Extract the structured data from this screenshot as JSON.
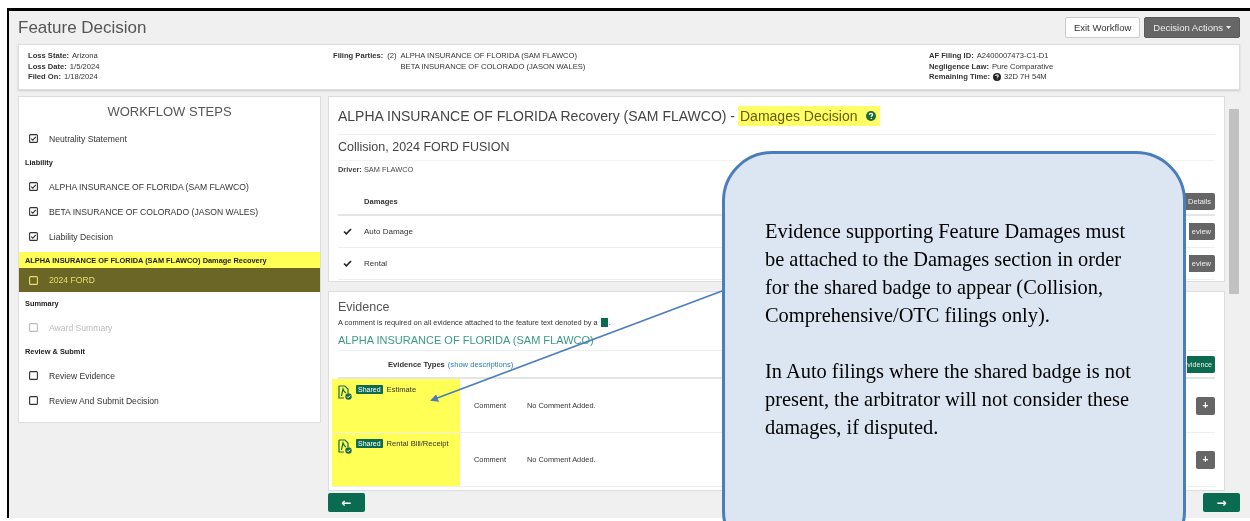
{
  "page": {
    "title": "Feature Decision",
    "buttons": [
      {
        "label": "Exit Workflow",
        "kind": "plain"
      },
      {
        "label": "Decision Actions",
        "kind": "dropdown"
      }
    ]
  },
  "summary": {
    "left": [
      {
        "label": "Loss State:",
        "value": "Arizona"
      },
      {
        "label": "Loss Date:",
        "value": "1/5/2024"
      },
      {
        "label": "Filed On:",
        "value": "1/18/2024"
      }
    ],
    "filing_parties": {
      "label": "Filing Parties:",
      "count": "(2)",
      "parties": [
        "ALPHA INSURANCE OF FLORIDA (SAM FLAWCO)",
        "BETA INSURANCE OF COLORADO (JASON WALES)"
      ]
    },
    "right": [
      {
        "label": "AF Filing ID:",
        "value": "A2400007473-C1-D1",
        "kind": "text"
      },
      {
        "label": "Negligence Law:",
        "value": "Pure Comparative",
        "kind": "text"
      },
      {
        "label": "Remaining Time:",
        "value": "32D 7H 54M",
        "kind": "help"
      }
    ]
  },
  "workflow": {
    "title": "WORKFLOW STEPS",
    "items": [
      {
        "kind": "step",
        "label": "Neutrality Statement",
        "checked": true,
        "disabled": false,
        "selected": false
      },
      {
        "kind": "heading",
        "label": "Liability",
        "highlighted": false
      },
      {
        "kind": "step",
        "label": "ALPHA INSURANCE OF FLORIDA (SAM FLAWCO)",
        "checked": true,
        "disabled": false,
        "selected": false
      },
      {
        "kind": "step",
        "label": "BETA INSURANCE OF COLORADO (JASON WALES)",
        "checked": true,
        "disabled": false,
        "selected": false
      },
      {
        "kind": "step",
        "label": "Liability Decision",
        "checked": true,
        "disabled": false,
        "selected": false
      },
      {
        "kind": "heading",
        "label": "ALPHA INSURANCE OF FLORIDA (SAM FLAWCO) Damage Recovery",
        "highlighted": true
      },
      {
        "kind": "step",
        "label": "2024 FORD",
        "checked": false,
        "disabled": false,
        "selected": true
      },
      {
        "kind": "heading",
        "label": "Summary",
        "highlighted": false
      },
      {
        "kind": "step",
        "label": "Award Summary",
        "checked": false,
        "disabled": true,
        "selected": false
      },
      {
        "kind": "heading",
        "label": "Review & Submit",
        "highlighted": false
      },
      {
        "kind": "step",
        "label": "Review Evidence",
        "checked": false,
        "disabled": false,
        "selected": false
      },
      {
        "kind": "step",
        "label": "Review And Submit Decision",
        "checked": false,
        "disabled": false,
        "selected": false
      }
    ]
  },
  "damages": {
    "title": "ALPHA INSURANCE OF FLORIDA Recovery (SAM FLAWCO) -",
    "title_highlight": "Damages Decision",
    "help": true,
    "vehicle": "Collision, 2024 FORD FUSION",
    "driver": "**Driver:** SAM FLAWCO",
    "column": "Damages",
    "header_action": "Details",
    "rows": [
      {
        "label": "Auto Damage",
        "checked": true,
        "action": "eview"
      },
      {
        "label": "Rental",
        "checked": true,
        "action": "eview"
      }
    ]
  },
  "evidence": {
    "title": "Evidence",
    "note": "A comment is required on all evidence attached to the feature text denoted by a",
    "note_end": ".",
    "party": "ALPHA INSURANCE OF FLORIDA (SAM FLAWCO)",
    "types_label": "Evidence Types",
    "types_link": "(show descriptions)",
    "add_action": "vidence",
    "items": [
      {
        "label": "Estimate",
        "badge": "Shared",
        "highlighted": true,
        "comment_label": "Comment",
        "comment": "No Comment Added.",
        "add": "+"
      },
      {
        "label": "Rental Bill/Receipt",
        "badge": "Shared",
        "highlighted": true,
        "comment_label": "Comment",
        "comment": "No Comment Added.",
        "add": "+"
      }
    ]
  },
  "nav": {
    "back": "←",
    "next": "→"
  },
  "callout": {
    "paragraphs": [
      "Evidence supporting Feature Damages must be attached to the Damages section in order for the shared badge to appear (Collision, Comprehensive/OTC filings only).",
      "In Auto filings where the shared badge is not present, the arbitrator will not consider these damages, if disputed."
    ]
  }
}
